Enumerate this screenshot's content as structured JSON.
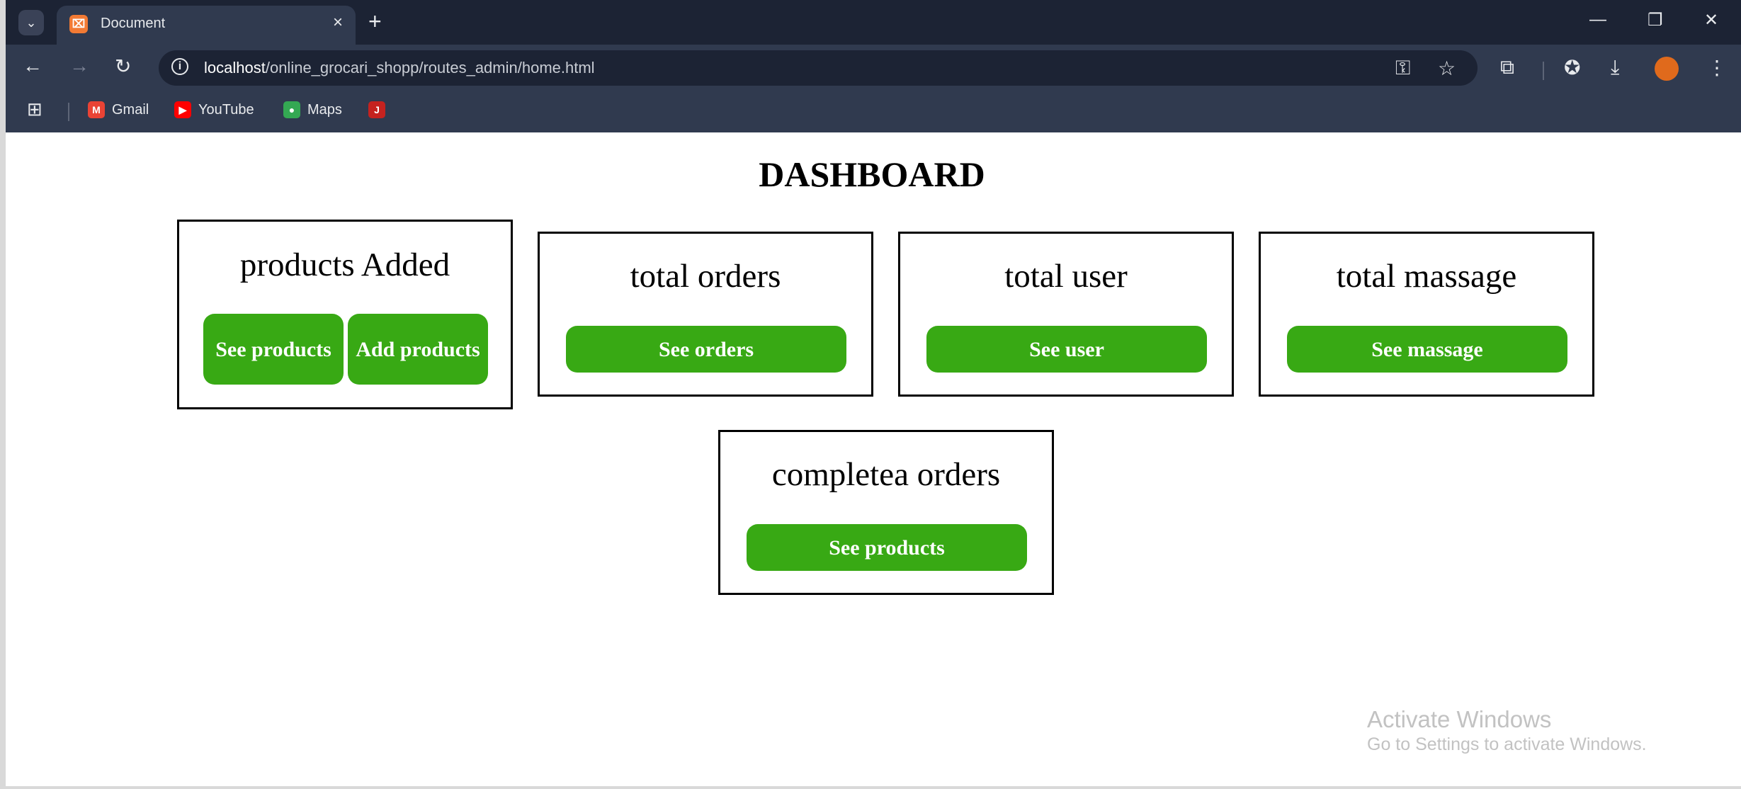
{
  "browser": {
    "tab": {
      "favicon": "⌧",
      "title": "Document"
    },
    "icons": {
      "tab_menu": "⌄",
      "close_tab": "×",
      "new_tab": "+",
      "minimize": "—",
      "restore": "❐",
      "close_window": "✕",
      "back": "←",
      "forward": "→",
      "reload": "↻",
      "info": "i",
      "key": "⚿",
      "star": "☆",
      "extensions": "⧉",
      "assistant": "✪",
      "download": "⤓",
      "menu": "⋮",
      "apps": "⊞"
    },
    "url": {
      "host": "localhost",
      "path": "/online_grocari_shopp/routes_admin/home.html"
    },
    "bookmarks": [
      {
        "icon": "M",
        "label": "Gmail",
        "color": "#ea4335"
      },
      {
        "icon": "▶",
        "label": "YouTube",
        "color": "#ff0000"
      },
      {
        "icon": "●",
        "label": "Maps",
        "color": "#34a853"
      },
      {
        "icon": "J",
        "label": "",
        "color": "#c5221f"
      }
    ]
  },
  "page": {
    "title": "DASHBOARD",
    "cards": [
      {
        "title": "products Added",
        "buttons": [
          "See products",
          "Add products"
        ]
      },
      {
        "title": "total orders",
        "buttons": [
          "See orders"
        ]
      },
      {
        "title": "total user",
        "buttons": [
          "See user"
        ]
      },
      {
        "title": "total massage",
        "buttons": [
          "See massage"
        ]
      },
      {
        "title": "completea orders",
        "buttons": [
          "See products"
        ]
      }
    ],
    "accent_color": "#38a914"
  },
  "watermark": {
    "title": "Activate Windows",
    "subtitle": "Go to Settings to activate Windows."
  }
}
